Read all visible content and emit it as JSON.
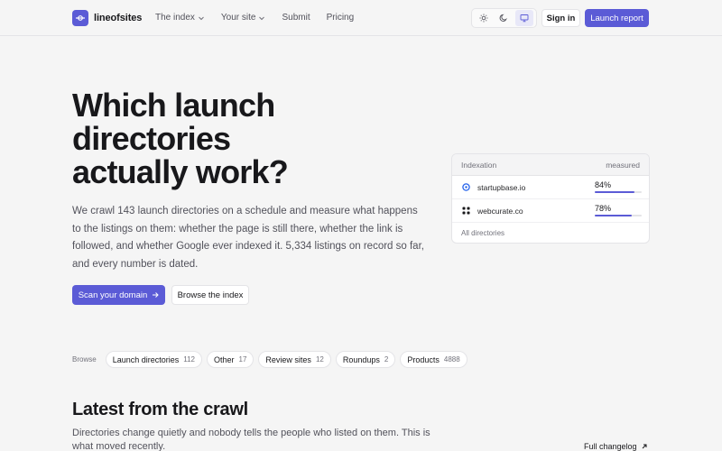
{
  "header": {
    "brand": "lineofsites",
    "nav": [
      {
        "label": "The index",
        "has_dropdown": true
      },
      {
        "label": "Your site",
        "has_dropdown": true
      },
      {
        "label": "Submit",
        "has_dropdown": false
      },
      {
        "label": "Pricing",
        "has_dropdown": false
      }
    ],
    "theme_options": [
      "sun-icon",
      "moon-icon",
      "monitor-icon"
    ],
    "theme_selected": "monitor-icon",
    "signin_label": "Sign in",
    "launch_label": "Launch report"
  },
  "hero": {
    "title_lines": [
      "Which launch",
      "directories",
      "actually work?"
    ],
    "description": "We crawl 143 launch directories on a schedule and measure what happens to the listings on them: whether the page is still there, whether the link is followed, and whether Google ever indexed it. 5,334 listings on record so far, and every number is dated.",
    "primary_cta": "Scan your domain",
    "secondary_cta": "Browse the index"
  },
  "indexation_card": {
    "title": "Indexation",
    "column": "measured",
    "rows": [
      {
        "name": "startupbase.io",
        "percent_label": "84%",
        "percent": 84,
        "icon": "circle-logo-icon"
      },
      {
        "name": "webcurate.co",
        "percent_label": "78%",
        "percent": 78,
        "icon": "grid-logo-icon"
      }
    ],
    "footer": "All directories"
  },
  "browse": {
    "label": "Browse",
    "chips": [
      {
        "label": "Launch directories",
        "count": "112"
      },
      {
        "label": "Other",
        "count": "17"
      },
      {
        "label": "Review sites",
        "count": "12"
      },
      {
        "label": "Roundups",
        "count": "2"
      },
      {
        "label": "Products",
        "count": "4888"
      }
    ]
  },
  "latest": {
    "title": "Latest from the crawl",
    "description": "Directories change quietly and nobody tells the people who listed on them. This is what moved recently.",
    "changelog_label": "Full changelog"
  },
  "colors": {
    "accent": "#5b5bd6",
    "background": "#f5f5f5",
    "text": "#18181b"
  }
}
